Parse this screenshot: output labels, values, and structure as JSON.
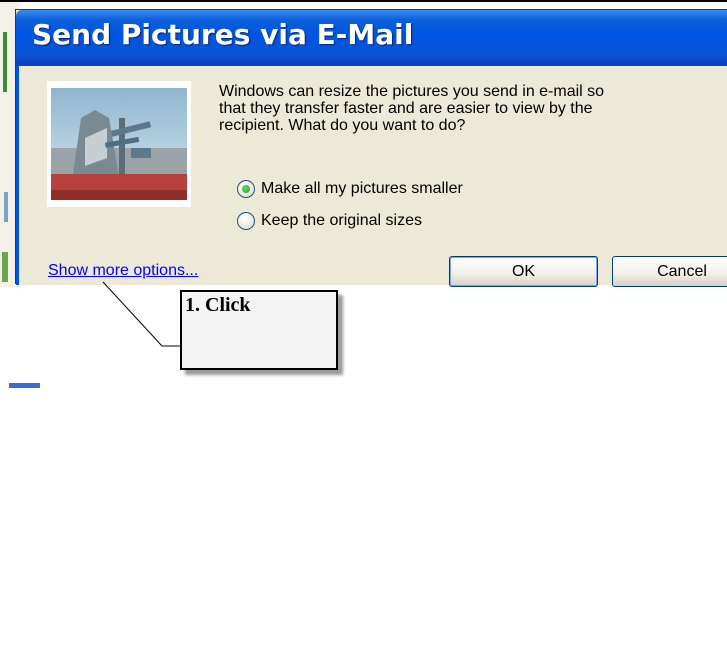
{
  "dialog": {
    "title": "Send Pictures via E-Mail",
    "message": "Windows can resize the pictures you send in e-mail so\nthat they transfer faster and are easier to view by the\nrecipient.  What do you want to do?",
    "options": [
      {
        "label": "Make all my pictures smaller",
        "selected": true
      },
      {
        "label": "Keep the original sizes",
        "selected": false
      }
    ],
    "more_options_link": "Show more options...",
    "ok_label": "OK",
    "cancel_label": "Cancel"
  },
  "annotation": {
    "callout_text": "1. Click"
  },
  "colors": {
    "title_bar": "#0054e3",
    "dialog_face": "#ece9d8",
    "link": "#0000ff",
    "callout_bg": "#f3f3f3"
  },
  "icons": {
    "radio_selected": "radio-selected-icon",
    "radio_unselected": "radio-unselected-icon"
  }
}
